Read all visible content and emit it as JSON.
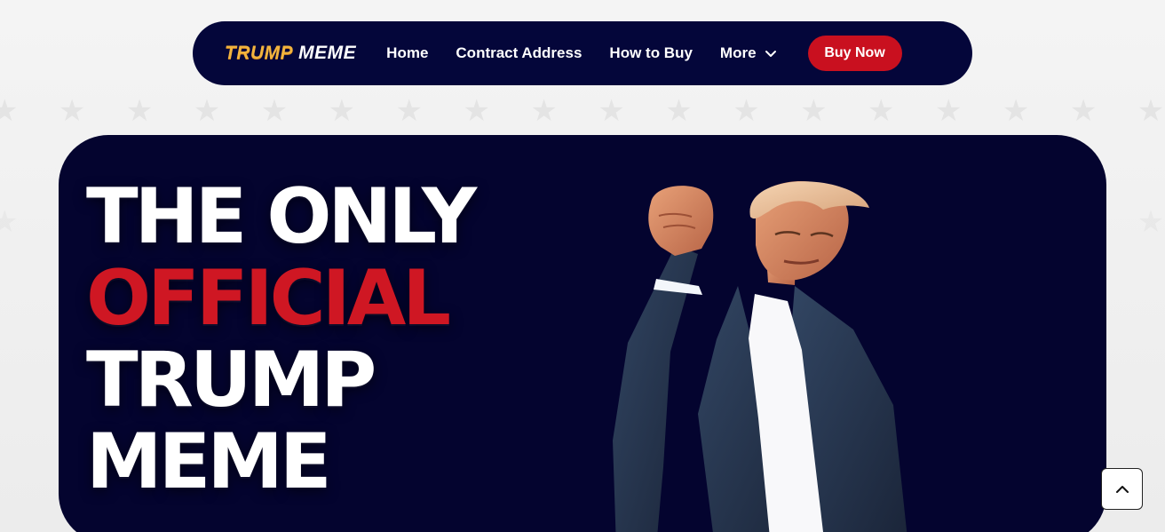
{
  "brand": {
    "trump_word": "TRUMP",
    "meme_word": "MEME",
    "accent_color": "#f2b43f"
  },
  "nav": {
    "items": [
      {
        "label": "Home"
      },
      {
        "label": "Contract Address"
      },
      {
        "label": "How to Buy"
      },
      {
        "label": "More"
      }
    ],
    "buy_label": "Buy Now"
  },
  "hero": {
    "line1": "THE ONLY",
    "line2": "OFFICIAL",
    "line3": "TRUMP",
    "line4": "MEME"
  },
  "colors": {
    "navy": "#04063a",
    "red": "#c9101f",
    "white": "#ffffff"
  },
  "icons": {
    "more_chevron": "chevron-down-icon",
    "back_to_top": "chevron-up-icon"
  }
}
